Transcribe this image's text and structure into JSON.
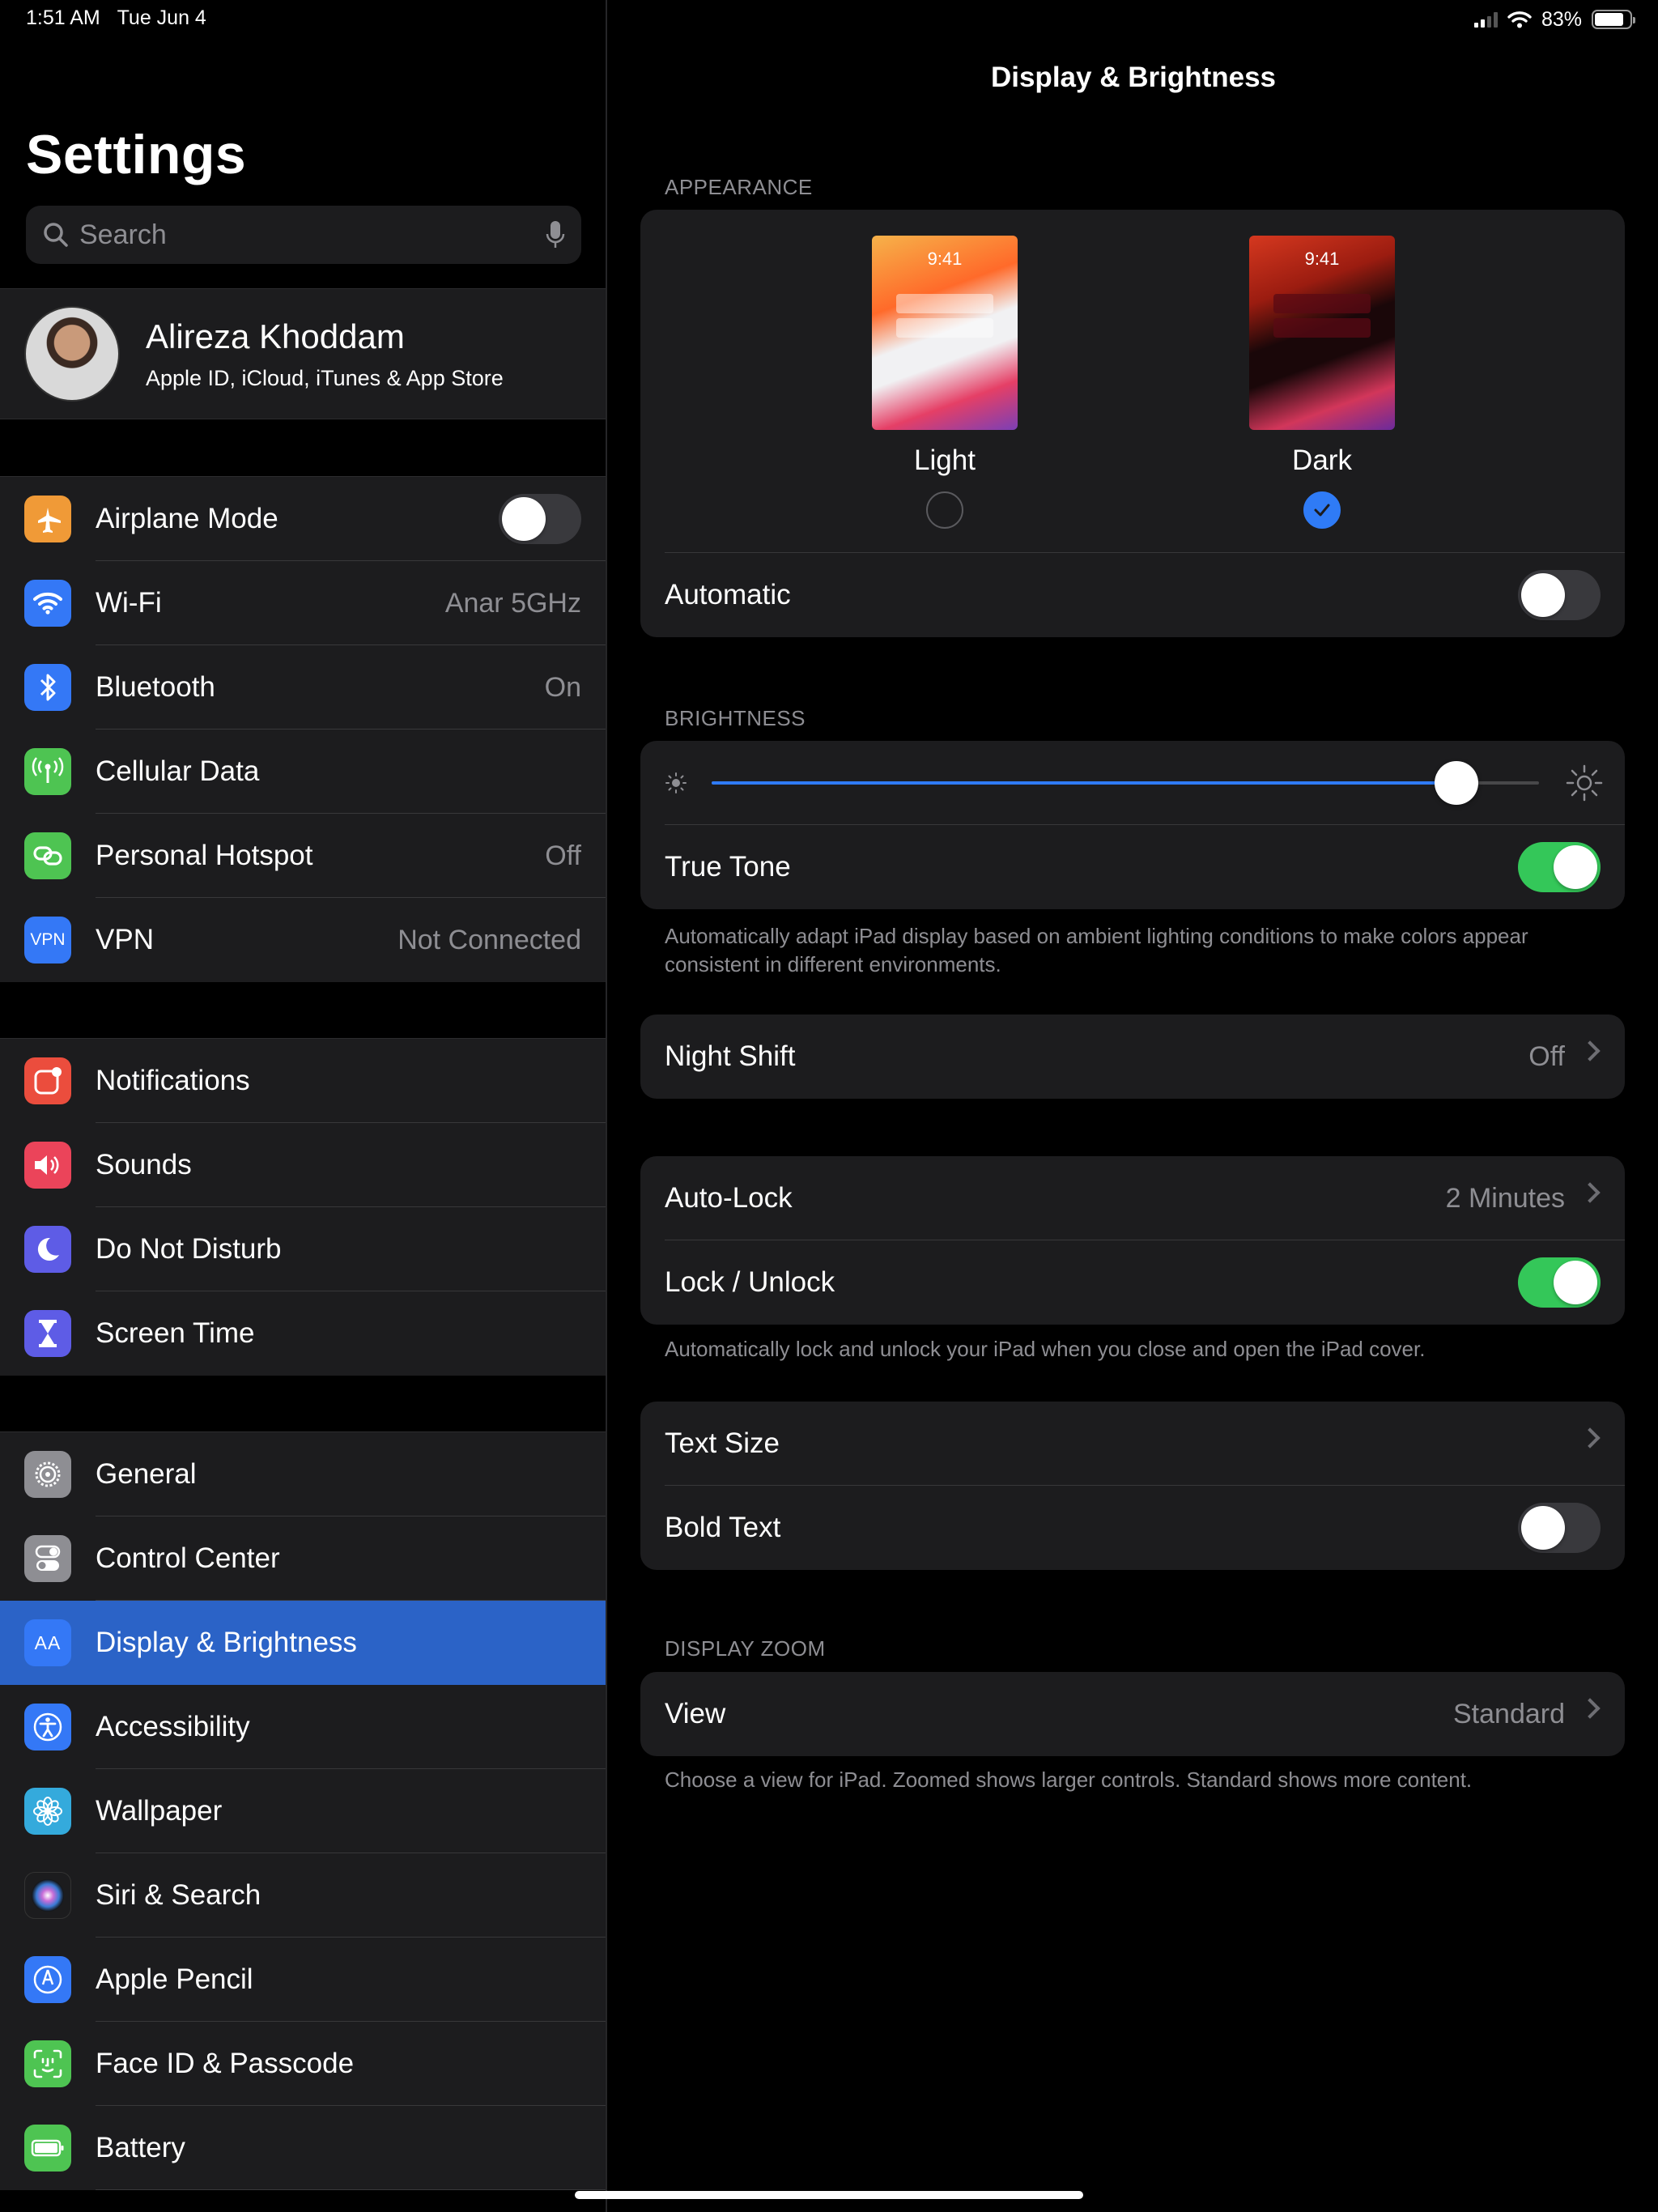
{
  "status_bar": {
    "time": "1:51 AM",
    "date": "Tue Jun 4",
    "battery": "83%",
    "battery_level": 0.83
  },
  "sidebar": {
    "title": "Settings",
    "search_placeholder": "Search",
    "profile": {
      "name": "Alireza Khoddam",
      "subtitle": "Apple ID, iCloud, iTunes & App Store"
    },
    "group1": [
      {
        "label": "Airplane Mode",
        "icon": "airplane-icon",
        "color": "#f09a37",
        "toggle": false
      },
      {
        "label": "Wi-Fi",
        "icon": "wifi-icon",
        "color": "#3478f6",
        "value": "Anar 5GHz"
      },
      {
        "label": "Bluetooth",
        "icon": "bluetooth-icon",
        "color": "#3478f6",
        "value": "On"
      },
      {
        "label": "Cellular Data",
        "icon": "antenna-icon",
        "color": "#4ec452"
      },
      {
        "label": "Personal Hotspot",
        "icon": "hotspot-icon",
        "color": "#4ec452",
        "value": "Off"
      },
      {
        "label": "VPN",
        "icon": "vpn-icon",
        "color": "#3478f6",
        "value": "Not Connected",
        "icon_text": "VPN"
      }
    ],
    "group2": [
      {
        "label": "Notifications",
        "icon": "notifications-icon",
        "color": "#eb4d3d"
      },
      {
        "label": "Sounds",
        "icon": "speaker-icon",
        "color": "#eb445a"
      },
      {
        "label": "Do Not Disturb",
        "icon": "moon-icon",
        "color": "#5e5ce6"
      },
      {
        "label": "Screen Time",
        "icon": "hourglass-icon",
        "color": "#5e5ce6"
      }
    ],
    "group3": [
      {
        "label": "General",
        "icon": "gear-icon",
        "color": "#8e8e93"
      },
      {
        "label": "Control Center",
        "icon": "switches-icon",
        "color": "#8e8e93"
      },
      {
        "label": "Display & Brightness",
        "icon": "text-size-icon",
        "color": "#3478f6",
        "icon_text": "AA",
        "selected": true
      },
      {
        "label": "Accessibility",
        "icon": "accessibility-icon",
        "color": "#3478f6"
      },
      {
        "label": "Wallpaper",
        "icon": "flower-icon",
        "color": "#34aadc"
      },
      {
        "label": "Siri & Search",
        "icon": "siri-icon",
        "color": "#1c1c1e"
      },
      {
        "label": "Apple Pencil",
        "icon": "pencil-icon",
        "color": "#3478f6"
      },
      {
        "label": "Face ID & Passcode",
        "icon": "face-id-icon",
        "color": "#4ec452"
      },
      {
        "label": "Battery",
        "icon": "battery-icon",
        "color": "#4ec452"
      }
    ]
  },
  "detail": {
    "title": "Display & Brightness",
    "appearance": {
      "header": "APPEARANCE",
      "preview_time": "9:41",
      "light_label": "Light",
      "dark_label": "Dark",
      "selected": "Dark",
      "automatic_label": "Automatic",
      "automatic_on": false
    },
    "brightness": {
      "header": "BRIGHTNESS",
      "level": 0.9,
      "true_tone_label": "True Tone",
      "true_tone_on": true,
      "footnote": "Automatically adapt iPad display based on ambient lighting conditions to make colors appear consistent in different environments."
    },
    "night_shift": {
      "label": "Night Shift",
      "value": "Off"
    },
    "lock": {
      "auto_lock_label": "Auto-Lock",
      "auto_lock_value": "2 Minutes",
      "lock_unlock_label": "Lock / Unlock",
      "lock_unlock_on": true,
      "footnote": "Automatically lock and unlock your iPad when you close and open the iPad cover."
    },
    "text": {
      "text_size_label": "Text Size",
      "bold_text_label": "Bold Text",
      "bold_text_on": false
    },
    "display_zoom": {
      "header": "DISPLAY ZOOM",
      "view_label": "View",
      "view_value": "Standard",
      "footnote": "Choose a view for iPad. Zoomed shows larger controls. Standard shows more content."
    }
  }
}
